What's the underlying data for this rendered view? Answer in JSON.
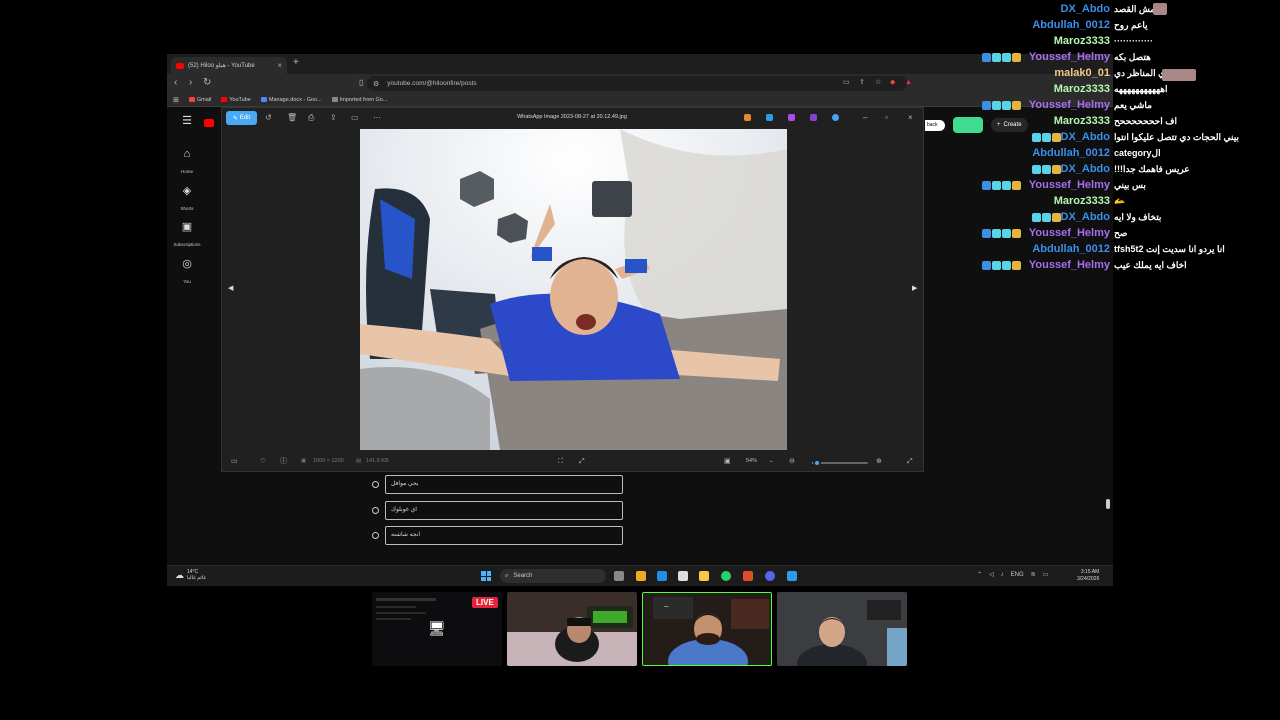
{
  "browser": {
    "tab_title": "(52) Hiloo هيلو - YouTube",
    "url": "youtube.com/@hiloonfire/posts",
    "bookmarks": [
      "Gmail",
      "YouTube",
      "Manage.docx - Goo...",
      "Imported from Go..."
    ]
  },
  "youtube": {
    "rail": [
      {
        "label": "Home",
        "icon": "home-icon"
      },
      {
        "label": "Shorts",
        "icon": "shorts-icon"
      },
      {
        "label": "Subscriptions",
        "icon": "subscriptions-icon"
      },
      {
        "label": "You",
        "icon": "user-icon"
      }
    ],
    "feedback_label": "back",
    "create_label": "Create",
    "poll_options": [
      "يحي موافل",
      "اي غوبلوك",
      "انجه شاشنه"
    ]
  },
  "viewer": {
    "edit_label": "Edit",
    "file_name": "WhatsApp Image 2023-08-27 at 20.12.49.jpg",
    "dimensions": "1600 × 1200",
    "file_size": "141.8 KB",
    "zoom": "54%",
    "zoom_fraction": 0.05
  },
  "taskbar": {
    "weather_temp": "14°C",
    "weather_desc": "غائم غالبا",
    "search_label": "Search",
    "lang": "ENG",
    "time": "3:15 AM",
    "date": "3/24/2026"
  },
  "chat": [
    {
      "user": "DX_Abdo",
      "color": "#3b8fe8",
      "message": "مش القصد",
      "badges": 0
    },
    {
      "user": "Abdullah_0012",
      "color": "#3b8fe8",
      "message": "ياعم روح",
      "badges": 0
    },
    {
      "user": "Maroz3333",
      "color": "#b6f7b0",
      "message": "·············",
      "badges": 0
    },
    {
      "user": "Youssef_Helmy",
      "color": "#a86cf0",
      "message": "هتصل بكه",
      "badges": 4
    },
    {
      "user": "malak0_01",
      "color": "#f3c98b",
      "message": "ي المناظر دي",
      "badges": 0
    },
    {
      "user": "Maroz3333",
      "color": "#b6f7b0",
      "message": "اهههههههههههه",
      "badges": 0
    },
    {
      "user": "Youssef_Helmy",
      "color": "#a86cf0",
      "message": "ماشي يعم",
      "badges": 4
    },
    {
      "user": "Maroz3333",
      "color": "#b6f7b0",
      "message": "اف احححححححح",
      "badges": 0
    },
    {
      "user": "DX_Abdo",
      "color": "#3b8fe8",
      "message": "بيني الحجات دي تتصل عليكوا انتوا",
      "badges": 3
    },
    {
      "user": "Abdullah_0012",
      "color": "#3b8fe8",
      "message": "الcategory",
      "badges": 0
    },
    {
      "user": "DX_Abdo",
      "color": "#3b8fe8",
      "message": "عريس فاهمك جدا!!!",
      "badges": 3
    },
    {
      "user": "Youssef_Helmy",
      "color": "#a86cf0",
      "message": "بس بيني",
      "badges": 4
    },
    {
      "user": "Maroz3333",
      "color": "#b6f7b0",
      "message": "🫴",
      "badges": 0
    },
    {
      "user": "DX_Abdo",
      "color": "#3b8fe8",
      "message": "بتخاف ولا ايه",
      "badges": 3
    },
    {
      "user": "Youssef_Helmy",
      "color": "#a86cf0",
      "message": "صح",
      "badges": 4
    },
    {
      "user": "Abdullah_0012",
      "color": "#3b8fe8",
      "message": "tfsh5tانا يردو انا سديت إنت 2",
      "badges": 0
    },
    {
      "user": "Youssef_Helmy",
      "color": "#a86cf0",
      "message": "اخاف ايه يملك عيب",
      "badges": 4
    }
  ],
  "stream": {
    "live_label": "LIVE"
  }
}
